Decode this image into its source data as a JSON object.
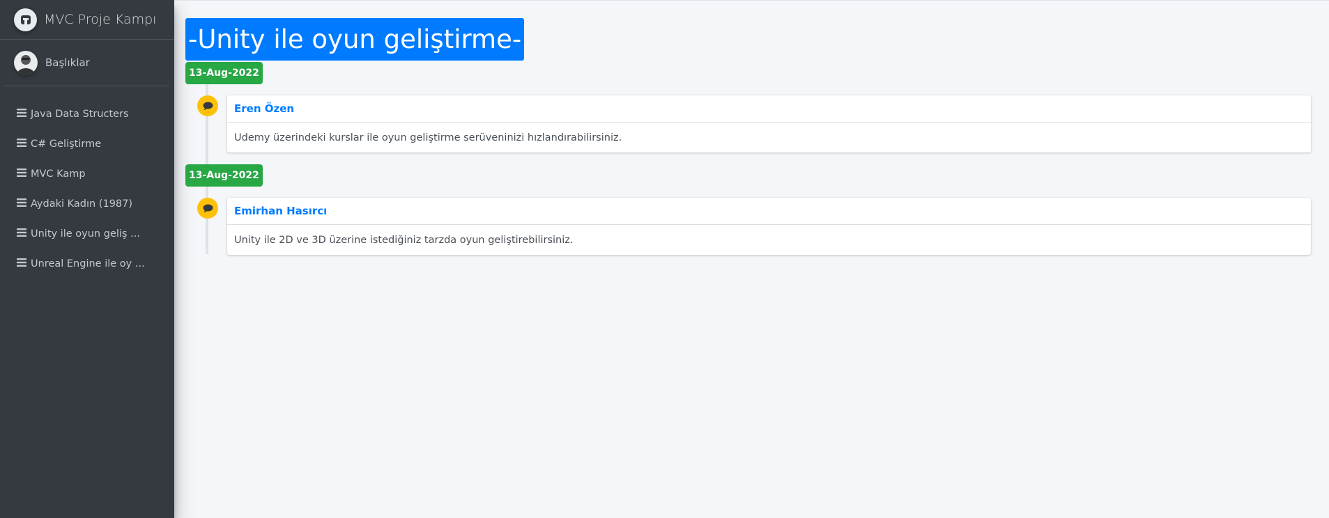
{
  "brand": {
    "title": "MVC Proje Kampı",
    "logo_icon": "robot-logo-icon"
  },
  "user_panel": {
    "name": "Başlıklar",
    "avatar_icon": "user-avatar-icon"
  },
  "sidebar": {
    "items": [
      {
        "label": "Java Data Structers",
        "icon": "bars-icon"
      },
      {
        "label": "C# Geliştirme",
        "icon": "bars-icon"
      },
      {
        "label": "MVC Kamp",
        "icon": "bars-icon"
      },
      {
        "label": "Aydaki Kadın (1987)",
        "icon": "bars-icon"
      },
      {
        "label": "Unity ile oyun geliş ...",
        "icon": "bars-icon"
      },
      {
        "label": "Unreal Engine ile oy ...",
        "icon": "bars-icon"
      }
    ]
  },
  "main": {
    "title": "-Unity ile oyun geliştirme-",
    "entries": [
      {
        "date": "13-Aug-2022",
        "author": "Eren Özen",
        "content": "Udemy üzerindeki kurslar ile oyun geliştirme serüveninizi hızlandırabilirsiniz.",
        "icon": "comment-icon"
      },
      {
        "date": "13-Aug-2022",
        "author": "Emirhan Hasırcı",
        "content": "Unity ile 2D ve 3D üzerine istediğiniz tarzda oyun geliştirebilirsiniz.",
        "icon": "comment-icon"
      }
    ]
  },
  "colors": {
    "sidebar_bg": "#343a40",
    "title_bg": "#007bff",
    "date_badge": "#28a745",
    "timeline_icon": "#ffc107",
    "author_link": "#007bff"
  }
}
